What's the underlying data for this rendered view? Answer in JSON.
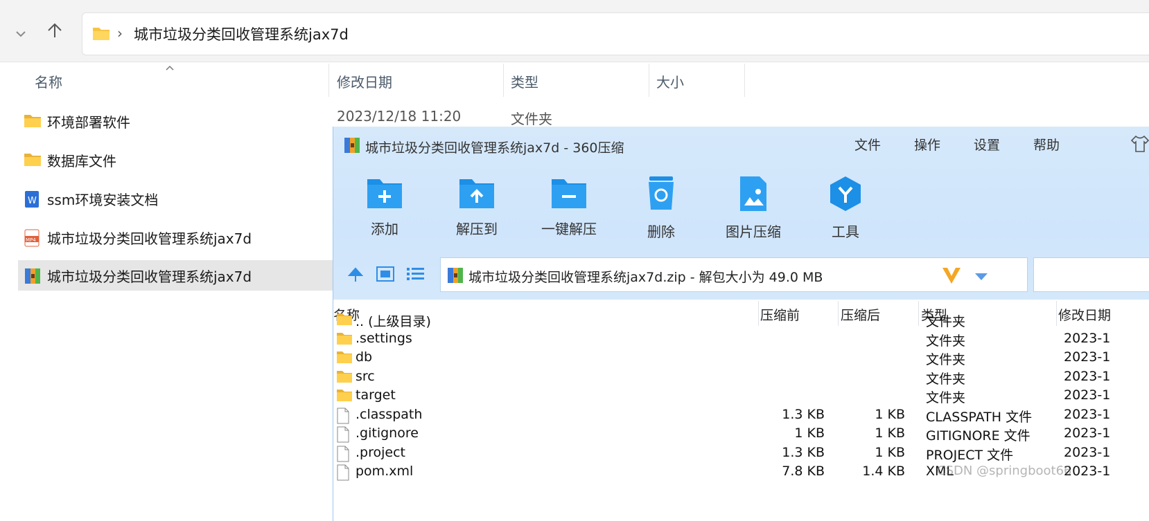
{
  "explorer": {
    "path": "城市垃圾分类回收管理系统jax7d",
    "columns": {
      "name": "名称",
      "modified": "修改日期",
      "type": "类型",
      "size": "大小"
    },
    "items": [
      {
        "name": "环境部署软件",
        "icon": "folder-icon",
        "date": "2023/12/18 11:20",
        "type": "文件夹"
      },
      {
        "name": "数据库文件",
        "icon": "folder-icon"
      },
      {
        "name": "ssm环境安装文档",
        "icon": "word-doc-icon"
      },
      {
        "name": "城市垃圾分类回收管理系统jax7d",
        "icon": "mp4-file-icon"
      },
      {
        "name": "城市垃圾分类回收管理系统jax7d",
        "icon": "zip-archive-icon",
        "selected": true
      }
    ]
  },
  "zipwin": {
    "title": "城市垃圾分类回收管理系统jax7d - 360压缩",
    "menu": [
      "文件",
      "操作",
      "设置",
      "帮助"
    ],
    "tools": [
      "添加",
      "解压到",
      "一键解压",
      "删除",
      "图片压缩",
      "工具"
    ],
    "path": "城市垃圾分类回收管理系统jax7d.zip - 解包大小为 49.0 MB",
    "columns": {
      "name": "名称",
      "before": "压缩前",
      "after": "压缩后",
      "type": "类型",
      "modified": "修改日期"
    },
    "rows": [
      {
        "name": ".. (上级目录)",
        "icon": "folder-icon",
        "before": "",
        "after": "",
        "type": "文件夹",
        "date": ""
      },
      {
        "name": ".settings",
        "icon": "folder-icon",
        "before": "",
        "after": "",
        "type": "文件夹",
        "date": "2023-1"
      },
      {
        "name": "db",
        "icon": "folder-icon",
        "before": "",
        "after": "",
        "type": "文件夹",
        "date": "2023-1"
      },
      {
        "name": "src",
        "icon": "folder-icon",
        "before": "",
        "after": "",
        "type": "文件夹",
        "date": "2023-1"
      },
      {
        "name": "target",
        "icon": "folder-icon",
        "before": "",
        "after": "",
        "type": "文件夹",
        "date": "2023-1"
      },
      {
        "name": ".classpath",
        "icon": "file-icon",
        "before": "1.3 KB",
        "after": "1 KB",
        "type": "CLASSPATH 文件",
        "date": "2023-1"
      },
      {
        "name": ".gitignore",
        "icon": "file-icon",
        "before": "1 KB",
        "after": "1 KB",
        "type": "GITIGNORE 文件",
        "date": "2023-1"
      },
      {
        "name": ".project",
        "icon": "file-icon",
        "before": "1.3 KB",
        "after": "1 KB",
        "type": "PROJECT 文件",
        "date": "2023-1"
      },
      {
        "name": "pom.xml",
        "icon": "file-icon",
        "before": "7.8 KB",
        "after": "1.4 KB",
        "type": "XML",
        "date": "2023-1"
      }
    ]
  },
  "watermark": "CSDN @springboot66"
}
